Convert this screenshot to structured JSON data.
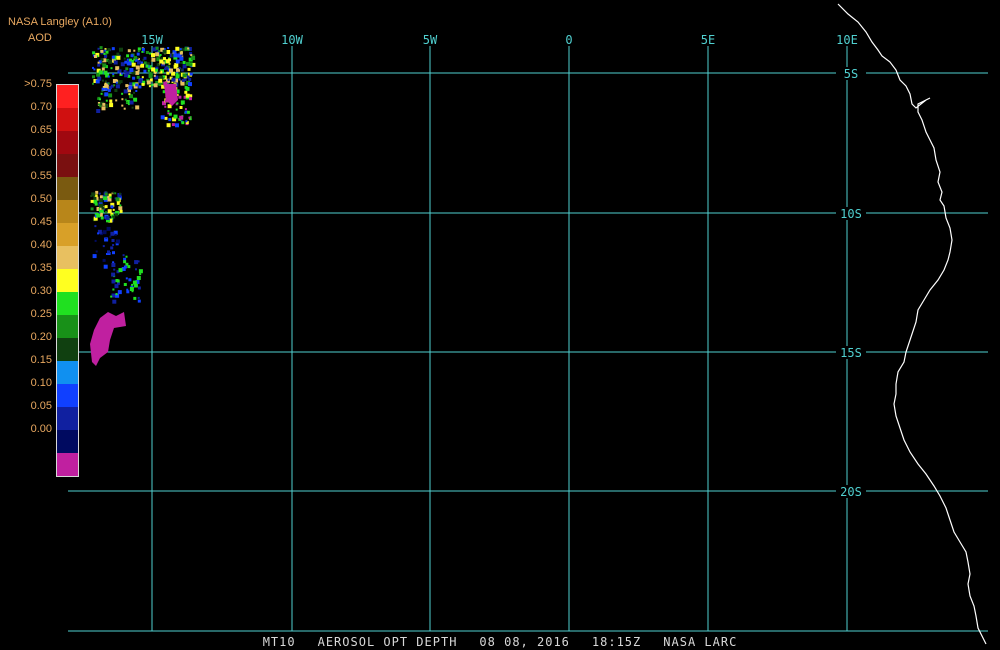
{
  "header": {
    "agency": "NASA Langley (A1.0)",
    "variable": "AOD"
  },
  "legend": {
    "labels": [
      ">0.75",
      "0.70",
      "0.65",
      "0.60",
      "0.55",
      "0.50",
      "0.45",
      "0.40",
      "0.35",
      "0.30",
      "0.25",
      "0.20",
      "0.15",
      "0.10",
      "0.05",
      "0.00"
    ],
    "colors": [
      "#ff2020",
      "#d01010",
      "#a00810",
      "#7a1010",
      "#7a5a10",
      "#b8861a",
      "#d8a028",
      "#e8c060",
      "#ffff20",
      "#20e020",
      "#189018",
      "#104010",
      "#1090f0",
      "#1040ff",
      "#1020a0",
      "#000a60",
      "#c020a0"
    ]
  },
  "map": {
    "lon_labels": [
      "15W",
      "10W",
      "5W",
      "0",
      "5E",
      "10E"
    ],
    "lat_labels": [
      "5S",
      "10S",
      "15S",
      "20S"
    ],
    "grid_color": "#50d0d0",
    "coast_color": "#ffffff"
  },
  "footer": {
    "satellite": "MT10",
    "product": "AEROSOL OPT DEPTH",
    "date": "08 08, 2016",
    "time": "18:15Z",
    "source": "NASA LARC"
  }
}
